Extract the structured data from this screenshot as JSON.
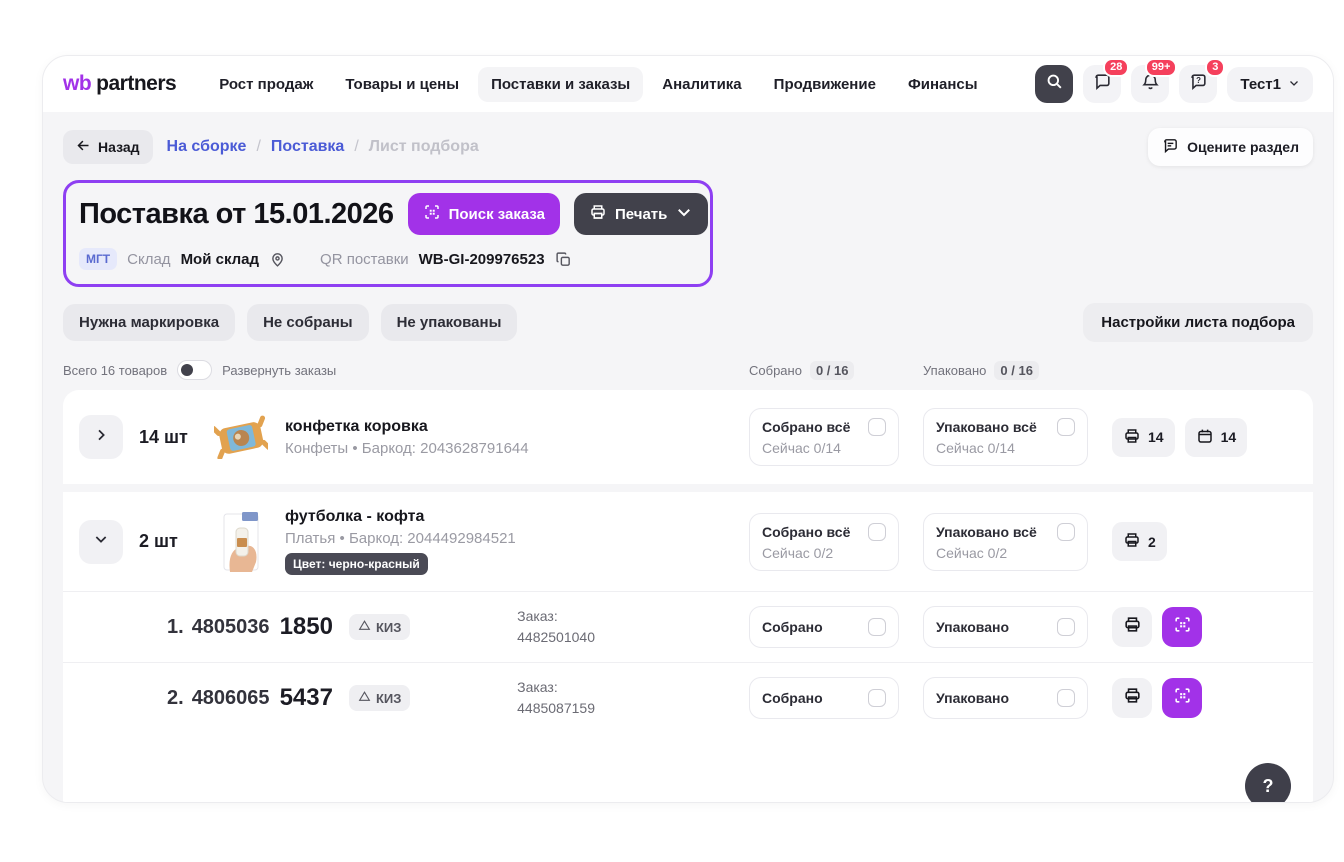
{
  "header": {
    "logo_wb": "wb",
    "logo_partners": "partners",
    "nav": [
      {
        "label": "Рост продаж"
      },
      {
        "label": "Товары и цены"
      },
      {
        "label": "Поставки и заказы"
      },
      {
        "label": "Аналитика"
      },
      {
        "label": "Продвижение"
      },
      {
        "label": "Финансы"
      }
    ],
    "chat_badge": "28",
    "bell_badge": "99+",
    "help_badge": "3",
    "account_name": "Тест1"
  },
  "breadcrumb": {
    "back_label": "Назад",
    "link1": "На сборке",
    "sep": "/",
    "link2": "Поставка",
    "current": "Лист подбора",
    "rate_button": "Оцените раздел"
  },
  "supply": {
    "title": "Поставка от 15.01.2026",
    "search_order_button": "Поиск заказа",
    "print_button": "Печать",
    "mgt_badge": "МГТ",
    "warehouse_label": "Склад",
    "warehouse_value": "Мой склад",
    "qr_label": "QR поставки",
    "qr_value": "WB-GI-209976523"
  },
  "filters": {
    "chip1": "Нужна маркировка",
    "chip2": "Не собраны",
    "chip3": "Не упакованы",
    "settings_button": "Настройки листа подбора"
  },
  "table": {
    "total_label": "Всего 16 товаров",
    "expand_toggle_label": "Развернуть заказы",
    "collected_header": "Собрано",
    "collected_count": "0 / 16",
    "packed_header": "Упаковано",
    "packed_count": "0 / 16",
    "groups": [
      {
        "qty": "14 шт",
        "name": "конфетка коровка",
        "subtitle": "Конфеты • Баркод: 2043628791644",
        "collected_label": "Собрано всё",
        "collected_now": "Сейчас 0/14",
        "packed_label": "Упаковано всё",
        "packed_now": "Сейчас 0/14",
        "print_count": "14",
        "calendar_count": "14"
      },
      {
        "qty": "2 шт",
        "name": "футболка - кофта",
        "subtitle": "Платья • Баркод: 2044492984521",
        "color_badge": "Цвет: черно-красный",
        "collected_label": "Собрано всё",
        "collected_now": "Сейчас 0/2",
        "packed_label": "Упаковано всё",
        "packed_now": "Сейчас 0/2",
        "print_count": "2"
      }
    ],
    "orders": [
      {
        "index": "1.",
        "article": "4805036",
        "size": "1850",
        "kiz_badge": "КИЗ",
        "order_label": "Заказ:",
        "order_number": "4482501040",
        "collected_label": "Собрано",
        "packed_label": "Упаковано"
      },
      {
        "index": "2.",
        "article": "4806065",
        "size": "5437",
        "kiz_badge": "КИЗ",
        "order_label": "Заказ:",
        "order_number": "4485087159",
        "collected_label": "Собрано",
        "packed_label": "Упаковано"
      }
    ]
  },
  "colors": {
    "accent_purple": "#a232e8",
    "highlight_ring": "#8e3ff2",
    "dark_button": "#41414b",
    "link_blue": "#4b5bd6",
    "badge_red": "#f5405c",
    "body_bg": "#f5f5f7"
  },
  "help_fab": "?"
}
